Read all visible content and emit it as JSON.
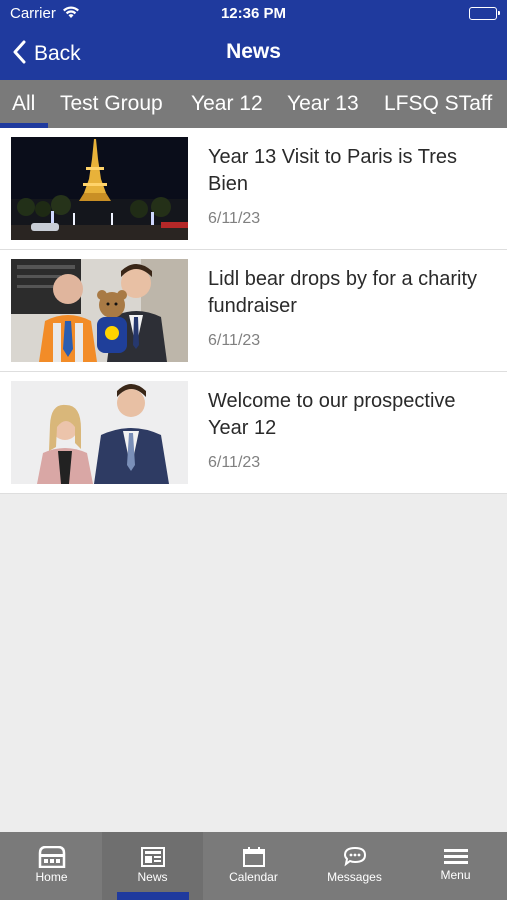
{
  "status_bar": {
    "carrier": "Carrier",
    "time": "12:36 PM"
  },
  "nav": {
    "back_label": "Back",
    "title": "News"
  },
  "tabs": [
    {
      "label": "All"
    },
    {
      "label": "Test Group"
    },
    {
      "label": "Year 12"
    },
    {
      "label": "Year 13"
    },
    {
      "label": "LFSQ STaff"
    }
  ],
  "selected_tab": "All",
  "news": [
    {
      "title": "Year 13 Visit to Paris is Tres Bien",
      "date": "6/11/23"
    },
    {
      "title": "Lidl bear drops by for a charity fundraiser",
      "date": "6/11/23"
    },
    {
      "title": "Welcome to our prospective Year 12",
      "date": "6/11/23"
    }
  ],
  "tab_bar": [
    {
      "label": "Home",
      "icon": "home-icon"
    },
    {
      "label": "News",
      "icon": "news-icon"
    },
    {
      "label": "Calendar",
      "icon": "calendar-icon"
    },
    {
      "label": "Messages",
      "icon": "messages-icon"
    },
    {
      "label": "Menu",
      "icon": "menu-icon"
    }
  ],
  "active_tab_bar": "News",
  "colors": {
    "brand": "#1f3a9e",
    "tab_grey": "#7a7a7a",
    "background": "#ededed"
  }
}
